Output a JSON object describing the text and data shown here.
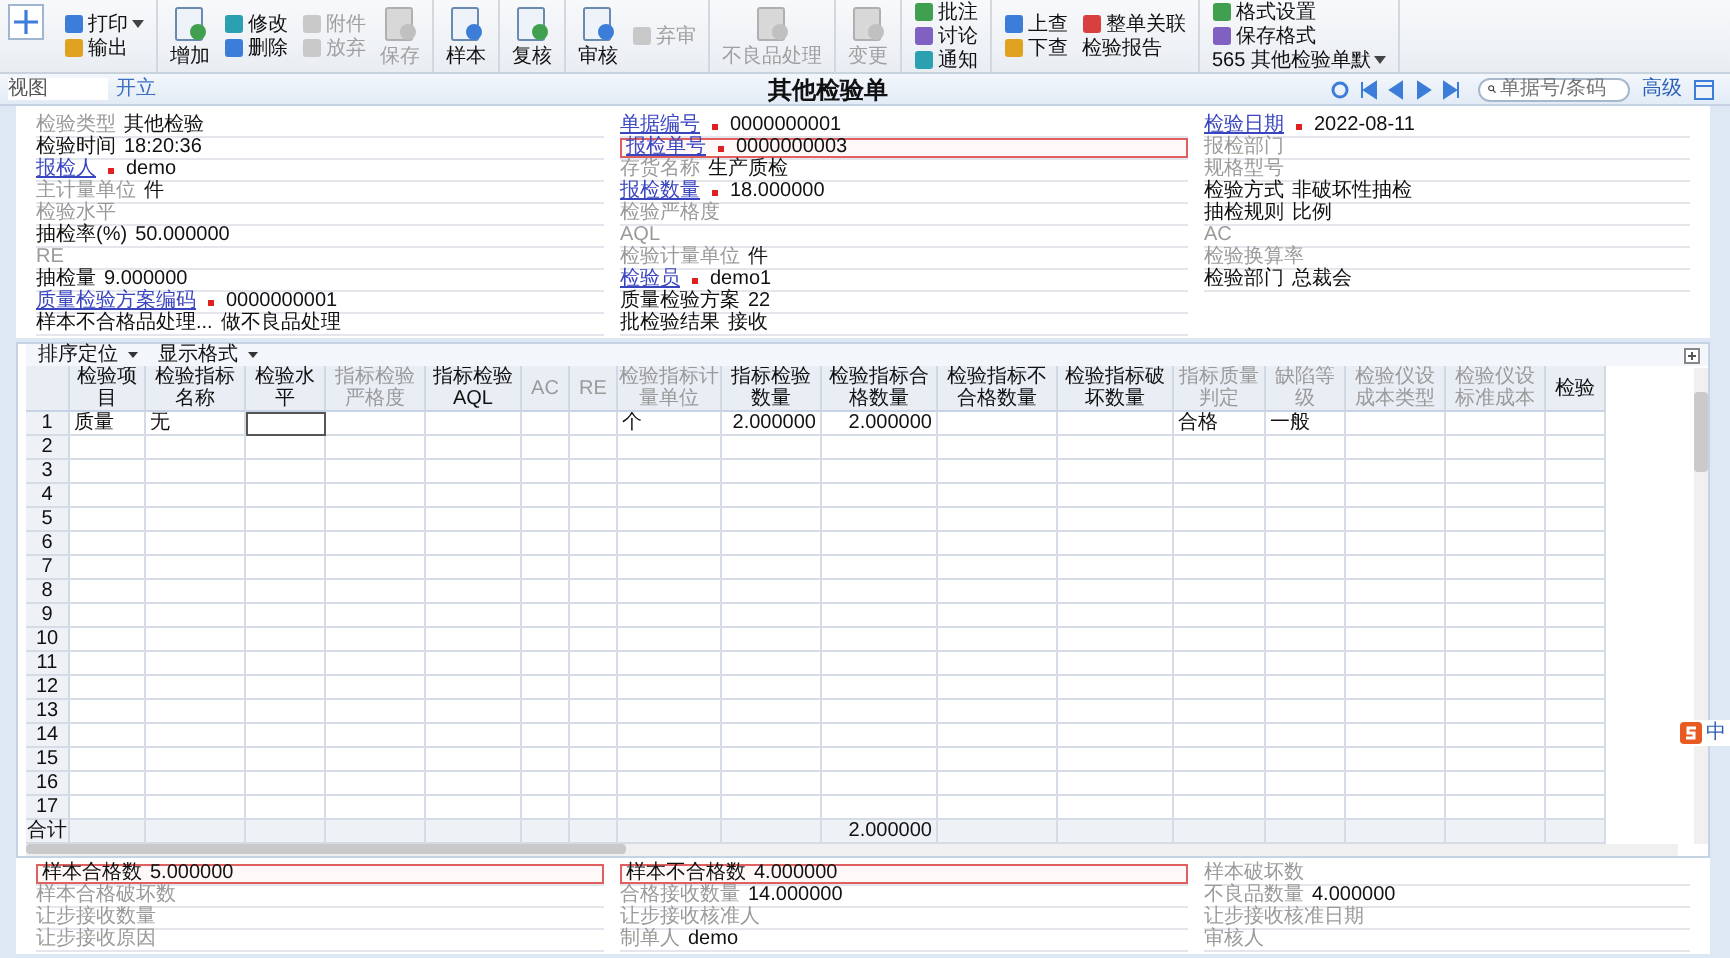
{
  "toolbar": [
    [
      [
        {
          "label": "打印",
          "kind": "small",
          "disabled": false,
          "menu": true
        },
        {
          "label": "输出",
          "kind": "small",
          "disabled": false,
          "menu": false
        }
      ]
    ],
    [
      [
        {
          "label": "增加",
          "kind": "big",
          "disabled": false,
          "menu": false
        }
      ],
      [
        {
          "label": "修改",
          "kind": "small",
          "disabled": false,
          "menu": false
        },
        {
          "label": "删除",
          "kind": "small",
          "disabled": false,
          "menu": false
        }
      ],
      [
        {
          "label": "附件",
          "kind": "small",
          "disabled": true,
          "menu": false
        },
        {
          "label": "放弃",
          "kind": "small",
          "disabled": true,
          "menu": false
        }
      ],
      [
        {
          "label": "保存",
          "kind": "big",
          "disabled": true,
          "menu": false
        }
      ]
    ],
    [
      [
        {
          "label": "样本",
          "kind": "big",
          "disabled": false,
          "menu": false
        }
      ]
    ],
    [
      [
        {
          "label": "复核",
          "kind": "big",
          "disabled": false,
          "menu": false
        }
      ]
    ],
    [
      [
        {
          "label": "审核",
          "kind": "big",
          "disabled": false,
          "menu": false
        }
      ],
      [
        {
          "label": "弃审",
          "kind": "small",
          "disabled": true,
          "menu": false
        }
      ]
    ],
    [
      [
        {
          "label": "不良品处理",
          "kind": "big",
          "disabled": true,
          "menu": false
        }
      ]
    ],
    [
      [
        {
          "label": "变更",
          "kind": "big",
          "disabled": true,
          "menu": false
        }
      ]
    ],
    [
      [
        {
          "label": "批注",
          "kind": "small",
          "disabled": false,
          "menu": false
        },
        {
          "label": "讨论",
          "kind": "small",
          "disabled": false,
          "menu": false
        },
        {
          "label": "通知",
          "kind": "small",
          "disabled": false,
          "menu": false
        }
      ]
    ],
    [
      [
        {
          "label": "上查",
          "kind": "small",
          "disabled": false,
          "menu": false
        },
        {
          "label": "下查",
          "kind": "small",
          "disabled": false,
          "menu": false
        }
      ],
      [
        {
          "label": "整单关联",
          "kind": "small",
          "disabled": false,
          "menu": false
        },
        {
          "label": "检验报告",
          "kind": "plain",
          "disabled": false,
          "menu": false
        }
      ]
    ],
    [
      [
        {
          "label": "格式设置",
          "kind": "small",
          "disabled": false,
          "menu": false
        },
        {
          "label": "保存格式",
          "kind": "small",
          "disabled": false,
          "menu": false
        },
        {
          "label": "565 其他检验单默",
          "kind": "plain",
          "disabled": false,
          "menu": true
        }
      ]
    ]
  ],
  "view_label": "视图",
  "status": "开立",
  "title": "其他检验单",
  "search": {
    "placeholder": "单据号/条码"
  },
  "advanced_link": "高级",
  "form": [
    [
      {
        "label": "检验类型",
        "value": "其他检验",
        "kind": "muted",
        "required": false,
        "highlighted": false
      },
      {
        "label": "检验时间",
        "value": "18:20:36",
        "kind": "strong",
        "required": false,
        "highlighted": false
      },
      {
        "label": "报检人",
        "value": "demo",
        "kind": "link",
        "required": true,
        "highlighted": false
      },
      {
        "label": "主计量单位",
        "value": "件",
        "kind": "muted",
        "required": false,
        "highlighted": false
      },
      {
        "label": "检验水平",
        "kind": "muted",
        "required": false,
        "highlighted": false
      },
      {
        "label": "抽检率(%)",
        "value": "50.000000",
        "kind": "strong",
        "required": false,
        "highlighted": false
      },
      {
        "label": "RE",
        "kind": "muted",
        "required": false,
        "highlighted": false
      },
      {
        "label": "抽检量",
        "value": "9.000000",
        "kind": "strong",
        "required": false,
        "highlighted": false
      },
      {
        "label": "质量检验方案编码",
        "value": "0000000001",
        "kind": "link",
        "required": true,
        "highlighted": false
      },
      {
        "label": "样本不合格品处理...",
        "value": "做不良品处理",
        "kind": "strong",
        "required": false,
        "highlighted": false
      }
    ],
    [
      {
        "label": "单据编号",
        "value": "0000000001",
        "kind": "link",
        "required": true,
        "highlighted": false
      },
      {
        "label": "报检单号",
        "value": "0000000003",
        "kind": "link",
        "required": true,
        "highlighted": true
      },
      {
        "label": "存货名称",
        "value": "生产质检",
        "kind": "muted",
        "required": false,
        "highlighted": false
      },
      {
        "label": "报检数量",
        "value": "18.000000",
        "kind": "link",
        "required": true,
        "highlighted": false
      },
      {
        "label": "检验严格度",
        "kind": "muted",
        "required": false,
        "highlighted": false
      },
      {
        "label": "AQL",
        "kind": "muted",
        "required": false,
        "highlighted": false
      },
      {
        "label": "检验计量单位",
        "value": "件",
        "kind": "muted",
        "required": false,
        "highlighted": false
      },
      {
        "label": "检验员",
        "value": "demo1",
        "kind": "link",
        "required": true,
        "highlighted": false
      },
      {
        "label": "质量检验方案",
        "value": "22",
        "kind": "strong",
        "required": false,
        "highlighted": false
      },
      {
        "label": "批检验结果",
        "value": "接收",
        "kind": "strong",
        "required": false,
        "highlighted": false
      }
    ],
    [
      {
        "label": "检验日期",
        "value": "2022-08-11",
        "kind": "link",
        "required": true,
        "highlighted": false
      },
      {
        "label": "报检部门",
        "kind": "muted",
        "required": false,
        "highlighted": false
      },
      {
        "label": "规格型号",
        "kind": "muted",
        "required": false,
        "highlighted": false
      },
      {
        "label": "检验方式",
        "value": "非破坏性抽检",
        "kind": "strong",
        "required": false,
        "highlighted": false
      },
      {
        "label": "抽检规则",
        "value": "比例",
        "kind": "strong",
        "required": false,
        "highlighted": false
      },
      {
        "label": "AC",
        "kind": "muted",
        "required": false,
        "highlighted": false
      },
      {
        "label": "检验换算率",
        "kind": "muted",
        "required": false,
        "highlighted": false
      },
      {
        "label": "检验部门",
        "value": "总裁会",
        "kind": "strong",
        "required": false,
        "highlighted": false
      }
    ]
  ],
  "table": {
    "menus": [
      "排序定位",
      "显示格式"
    ],
    "columns": [
      {
        "label": "检验项目",
        "muted": false
      },
      {
        "label": "检验指标名称",
        "muted": false
      },
      {
        "label": "检验水平",
        "muted": false
      },
      {
        "label": "指标检验严格度",
        "muted": true
      },
      {
        "label": "指标检验AQL",
        "muted": false
      },
      {
        "label": "AC",
        "muted": true
      },
      {
        "label": "RE",
        "muted": true
      },
      {
        "label": "检验指标计量单位",
        "muted": true
      },
      {
        "label": "指标检验数量",
        "muted": false
      },
      {
        "label": "检验指标合格数量",
        "muted": false
      },
      {
        "label": "检验指标不合格数量",
        "muted": false
      },
      {
        "label": "检验指标破坏数量",
        "muted": false
      },
      {
        "label": "指标质量判定",
        "muted": true
      },
      {
        "label": "缺陷等级",
        "muted": true
      },
      {
        "label": "检验仪设成本类型",
        "muted": true
      },
      {
        "label": "检验仪设标准成本",
        "muted": true
      },
      {
        "label": "检验",
        "muted": false
      }
    ],
    "rows": [
      {
        "number": "1",
        "cells": [
          "质量",
          "无",
          {
            "editing": true
          },
          null,
          null,
          null,
          null,
          "个",
          "2.000000",
          "2.000000",
          null,
          null,
          "合格",
          "一般"
        ]
      },
      {
        "number": "2"
      },
      {
        "number": "3"
      },
      {
        "number": "4"
      },
      {
        "number": "5"
      },
      {
        "number": "6"
      },
      {
        "number": "7"
      },
      {
        "number": "8"
      },
      {
        "number": "9"
      },
      {
        "number": "10"
      },
      {
        "number": "11"
      },
      {
        "number": "12"
      },
      {
        "number": "13"
      },
      {
        "number": "14"
      },
      {
        "number": "15"
      },
      {
        "number": "16"
      },
      {
        "number": "17"
      }
    ],
    "total": {
      "label": "合计",
      "cells": [
        null,
        null,
        null,
        null,
        null,
        null,
        null,
        null,
        null,
        "2.000000"
      ]
    }
  },
  "footer": [
    [
      {
        "label": "样本合格数",
        "value": "5.000000",
        "kind": "strong",
        "required": false,
        "highlighted": true
      },
      {
        "label": "样本合格破坏数",
        "kind": "muted",
        "required": false,
        "highlighted": false
      },
      {
        "label": "让步接收数量",
        "kind": "muted",
        "required": false,
        "highlighted": false
      },
      {
        "label": "让步接收原因",
        "kind": "muted",
        "required": false,
        "highlighted": false
      }
    ],
    [
      {
        "label": "样本不合格数",
        "value": "4.000000",
        "kind": "strong",
        "required": false,
        "highlighted": true
      },
      {
        "label": "合格接收数量",
        "value": "14.000000",
        "kind": "muted",
        "required": false,
        "highlighted": false
      },
      {
        "label": "让步接收核准人",
        "kind": "muted",
        "required": false,
        "highlighted": false
      },
      {
        "label": "制单人",
        "value": "demo",
        "kind": "muted",
        "required": false,
        "highlighted": false
      }
    ],
    [
      {
        "label": "样本破坏数",
        "kind": "muted",
        "required": false,
        "highlighted": false
      },
      {
        "label": "不良品数量",
        "value": "4.000000",
        "kind": "muted",
        "required": false,
        "highlighted": false
      },
      {
        "label": "让步接收核准日期",
        "kind": "muted",
        "required": false,
        "highlighted": false
      },
      {
        "label": "审核人",
        "kind": "muted",
        "required": false,
        "highlighted": false
      }
    ]
  ],
  "ime": {
    "label": "中"
  }
}
